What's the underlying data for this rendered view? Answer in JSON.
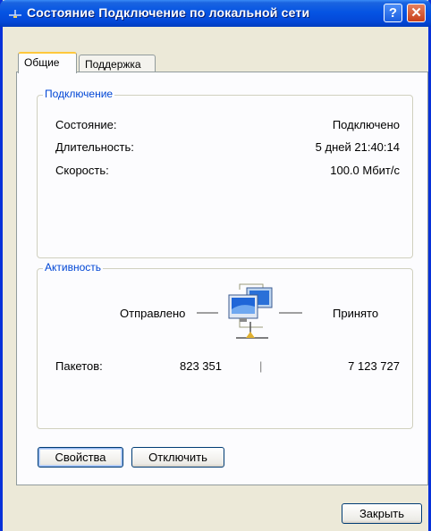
{
  "window": {
    "title": "Состояние Подключение по локальной сети",
    "help_button": "?",
    "close_button": "✕"
  },
  "tabs": [
    {
      "label": "Общие",
      "active": true
    },
    {
      "label": "Поддержка",
      "active": false
    }
  ],
  "connection": {
    "legend": "Подключение",
    "rows": [
      {
        "label": "Состояние:",
        "value": "Подключено"
      },
      {
        "label": "Длительность:",
        "value": "5 дней 21:40:14"
      },
      {
        "label": "Скорость:",
        "value": "100.0 Мбит/с"
      }
    ]
  },
  "activity": {
    "legend": "Активность",
    "sent_label": "Отправлено",
    "received_label": "Принято",
    "packets_label": "Пакетов:",
    "packets_sent": "823 351",
    "packets_received": "7 123 727",
    "separator": "|"
  },
  "buttons": {
    "properties": "Свойства",
    "disable": "Отключить",
    "close": "Закрыть"
  },
  "colors": {
    "titlebar": "#0554e3",
    "accent_text": "#0046d5",
    "active_tab_highlight": "#ffc83c"
  }
}
